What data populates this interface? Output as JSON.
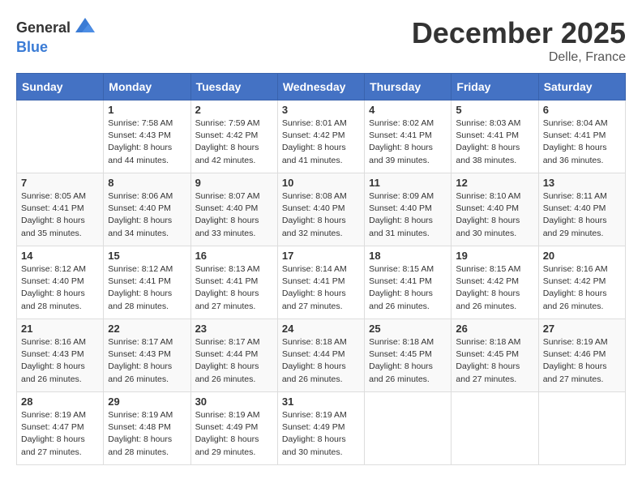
{
  "header": {
    "logo_general": "General",
    "logo_blue": "Blue",
    "month_year": "December 2025",
    "location": "Delle, France"
  },
  "weekdays": [
    "Sunday",
    "Monday",
    "Tuesday",
    "Wednesday",
    "Thursday",
    "Friday",
    "Saturday"
  ],
  "weeks": [
    [
      {
        "day": "",
        "sunrise": "",
        "sunset": "",
        "daylight": ""
      },
      {
        "day": "1",
        "sunrise": "Sunrise: 7:58 AM",
        "sunset": "Sunset: 4:43 PM",
        "daylight": "Daylight: 8 hours and 44 minutes."
      },
      {
        "day": "2",
        "sunrise": "Sunrise: 7:59 AM",
        "sunset": "Sunset: 4:42 PM",
        "daylight": "Daylight: 8 hours and 42 minutes."
      },
      {
        "day": "3",
        "sunrise": "Sunrise: 8:01 AM",
        "sunset": "Sunset: 4:42 PM",
        "daylight": "Daylight: 8 hours and 41 minutes."
      },
      {
        "day": "4",
        "sunrise": "Sunrise: 8:02 AM",
        "sunset": "Sunset: 4:41 PM",
        "daylight": "Daylight: 8 hours and 39 minutes."
      },
      {
        "day": "5",
        "sunrise": "Sunrise: 8:03 AM",
        "sunset": "Sunset: 4:41 PM",
        "daylight": "Daylight: 8 hours and 38 minutes."
      },
      {
        "day": "6",
        "sunrise": "Sunrise: 8:04 AM",
        "sunset": "Sunset: 4:41 PM",
        "daylight": "Daylight: 8 hours and 36 minutes."
      }
    ],
    [
      {
        "day": "7",
        "sunrise": "Sunrise: 8:05 AM",
        "sunset": "Sunset: 4:41 PM",
        "daylight": "Daylight: 8 hours and 35 minutes."
      },
      {
        "day": "8",
        "sunrise": "Sunrise: 8:06 AM",
        "sunset": "Sunset: 4:40 PM",
        "daylight": "Daylight: 8 hours and 34 minutes."
      },
      {
        "day": "9",
        "sunrise": "Sunrise: 8:07 AM",
        "sunset": "Sunset: 4:40 PM",
        "daylight": "Daylight: 8 hours and 33 minutes."
      },
      {
        "day": "10",
        "sunrise": "Sunrise: 8:08 AM",
        "sunset": "Sunset: 4:40 PM",
        "daylight": "Daylight: 8 hours and 32 minutes."
      },
      {
        "day": "11",
        "sunrise": "Sunrise: 8:09 AM",
        "sunset": "Sunset: 4:40 PM",
        "daylight": "Daylight: 8 hours and 31 minutes."
      },
      {
        "day": "12",
        "sunrise": "Sunrise: 8:10 AM",
        "sunset": "Sunset: 4:40 PM",
        "daylight": "Daylight: 8 hours and 30 minutes."
      },
      {
        "day": "13",
        "sunrise": "Sunrise: 8:11 AM",
        "sunset": "Sunset: 4:40 PM",
        "daylight": "Daylight: 8 hours and 29 minutes."
      }
    ],
    [
      {
        "day": "14",
        "sunrise": "Sunrise: 8:12 AM",
        "sunset": "Sunset: 4:40 PM",
        "daylight": "Daylight: 8 hours and 28 minutes."
      },
      {
        "day": "15",
        "sunrise": "Sunrise: 8:12 AM",
        "sunset": "Sunset: 4:41 PM",
        "daylight": "Daylight: 8 hours and 28 minutes."
      },
      {
        "day": "16",
        "sunrise": "Sunrise: 8:13 AM",
        "sunset": "Sunset: 4:41 PM",
        "daylight": "Daylight: 8 hours and 27 minutes."
      },
      {
        "day": "17",
        "sunrise": "Sunrise: 8:14 AM",
        "sunset": "Sunset: 4:41 PM",
        "daylight": "Daylight: 8 hours and 27 minutes."
      },
      {
        "day": "18",
        "sunrise": "Sunrise: 8:15 AM",
        "sunset": "Sunset: 4:41 PM",
        "daylight": "Daylight: 8 hours and 26 minutes."
      },
      {
        "day": "19",
        "sunrise": "Sunrise: 8:15 AM",
        "sunset": "Sunset: 4:42 PM",
        "daylight": "Daylight: 8 hours and 26 minutes."
      },
      {
        "day": "20",
        "sunrise": "Sunrise: 8:16 AM",
        "sunset": "Sunset: 4:42 PM",
        "daylight": "Daylight: 8 hours and 26 minutes."
      }
    ],
    [
      {
        "day": "21",
        "sunrise": "Sunrise: 8:16 AM",
        "sunset": "Sunset: 4:43 PM",
        "daylight": "Daylight: 8 hours and 26 minutes."
      },
      {
        "day": "22",
        "sunrise": "Sunrise: 8:17 AM",
        "sunset": "Sunset: 4:43 PM",
        "daylight": "Daylight: 8 hours and 26 minutes."
      },
      {
        "day": "23",
        "sunrise": "Sunrise: 8:17 AM",
        "sunset": "Sunset: 4:44 PM",
        "daylight": "Daylight: 8 hours and 26 minutes."
      },
      {
        "day": "24",
        "sunrise": "Sunrise: 8:18 AM",
        "sunset": "Sunset: 4:44 PM",
        "daylight": "Daylight: 8 hours and 26 minutes."
      },
      {
        "day": "25",
        "sunrise": "Sunrise: 8:18 AM",
        "sunset": "Sunset: 4:45 PM",
        "daylight": "Daylight: 8 hours and 26 minutes."
      },
      {
        "day": "26",
        "sunrise": "Sunrise: 8:18 AM",
        "sunset": "Sunset: 4:45 PM",
        "daylight": "Daylight: 8 hours and 27 minutes."
      },
      {
        "day": "27",
        "sunrise": "Sunrise: 8:19 AM",
        "sunset": "Sunset: 4:46 PM",
        "daylight": "Daylight: 8 hours and 27 minutes."
      }
    ],
    [
      {
        "day": "28",
        "sunrise": "Sunrise: 8:19 AM",
        "sunset": "Sunset: 4:47 PM",
        "daylight": "Daylight: 8 hours and 27 minutes."
      },
      {
        "day": "29",
        "sunrise": "Sunrise: 8:19 AM",
        "sunset": "Sunset: 4:48 PM",
        "daylight": "Daylight: 8 hours and 28 minutes."
      },
      {
        "day": "30",
        "sunrise": "Sunrise: 8:19 AM",
        "sunset": "Sunset: 4:49 PM",
        "daylight": "Daylight: 8 hours and 29 minutes."
      },
      {
        "day": "31",
        "sunrise": "Sunrise: 8:19 AM",
        "sunset": "Sunset: 4:49 PM",
        "daylight": "Daylight: 8 hours and 30 minutes."
      },
      {
        "day": "",
        "sunrise": "",
        "sunset": "",
        "daylight": ""
      },
      {
        "day": "",
        "sunrise": "",
        "sunset": "",
        "daylight": ""
      },
      {
        "day": "",
        "sunrise": "",
        "sunset": "",
        "daylight": ""
      }
    ]
  ]
}
